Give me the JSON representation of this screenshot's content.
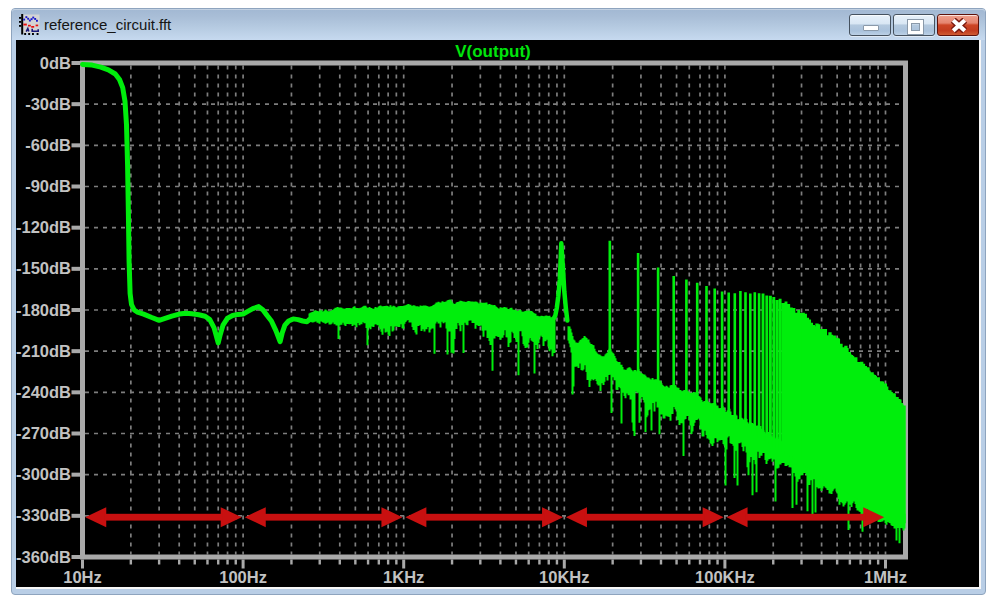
{
  "window": {
    "title": "reference_circuit.fft",
    "icon": "waveform-plot-icon",
    "buttons": {
      "minimize": "Minimize",
      "maximize": "Maximize",
      "close": "Close"
    }
  },
  "colors": {
    "frame": "#B9CEE6",
    "client_bg": "#000000",
    "plot_border": "#A9A9A9",
    "grid": "#7E7E7E",
    "axis_label": "#C2C2C2",
    "trace": "#00EE0C",
    "plot_title": "#00E40C",
    "arrow": "#C81010"
  },
  "chart_data": {
    "type": "line",
    "title": "V(output)",
    "xlabel": "",
    "ylabel": "",
    "x_axis": {
      "scale": "log",
      "unit": "Hz",
      "range_hz": [
        10,
        1330000
      ],
      "tick_labels": [
        "10Hz",
        "100Hz",
        "1KHz",
        "10KHz",
        "100KHz",
        "1MHz"
      ],
      "tick_values_hz": [
        10,
        100,
        1000,
        10000,
        100000,
        1000000
      ],
      "minor_multiples": [
        2,
        3,
        4,
        5,
        6,
        7,
        8,
        9,
        10
      ]
    },
    "y_axis": {
      "unit": "dB",
      "range_db": [
        -360,
        0
      ],
      "grid_step_db": 30,
      "tick_labels": [
        "0dB",
        "-30dB",
        "-60dB",
        "-90dB",
        "-120dB",
        "-150dB",
        "-180dB",
        "-210dB",
        "-240dB",
        "-270dB",
        "-300dB",
        "-330dB",
        "-360dB"
      ],
      "tick_values_db": [
        0,
        -30,
        -60,
        -90,
        -120,
        -150,
        -180,
        -210,
        -240,
        -270,
        -300,
        -330,
        -360
      ]
    },
    "grid": {
      "style": "dashed",
      "horizontal_at_db": [
        -30,
        -60,
        -90,
        -120,
        -150,
        -180,
        -210,
        -240,
        -270,
        -300,
        -330
      ]
    },
    "legend": {
      "position": "top-center",
      "entries": [
        "V(output)"
      ]
    },
    "series": [
      {
        "name": "V(output)",
        "color": "#00EE0C",
        "description": "FFT magnitude of V(output): 0dB fundamental plateau 10-19Hz, cliff to -180dB noise floor, resonance spike to -127dB near 9.6KHz, harmonic comb at multiples of 9.6KHz decaying into a dense wedge that rolls off to about -330dB at 1MHz",
        "clean_line_db": [
          [
            10,
            -1
          ],
          [
            11.5,
            -1.5
          ],
          [
            13,
            -3
          ],
          [
            14.5,
            -5
          ],
          [
            16,
            -8
          ],
          [
            17,
            -12
          ],
          [
            17.8,
            -18
          ],
          [
            18.4,
            -28
          ],
          [
            18.8,
            -45
          ],
          [
            19.1,
            -75
          ],
          [
            19.3,
            -110
          ],
          [
            19.5,
            -145
          ],
          [
            19.8,
            -168
          ],
          [
            20.2,
            -176
          ],
          [
            21,
            -180
          ],
          [
            22,
            -181.5
          ],
          [
            24,
            -183
          ],
          [
            27,
            -185.5
          ],
          [
            30,
            -187.5
          ],
          [
            33,
            -186
          ],
          [
            36,
            -184.5
          ],
          [
            40,
            -183
          ],
          [
            44,
            -182.3
          ],
          [
            48,
            -182.8
          ],
          [
            53,
            -183.5
          ],
          [
            58,
            -184.5
          ],
          [
            62,
            -187
          ],
          [
            66,
            -193
          ],
          [
            70,
            -204
          ],
          [
            72,
            -198
          ],
          [
            75,
            -191
          ],
          [
            80,
            -186
          ],
          [
            86,
            -184
          ],
          [
            93,
            -183.2
          ],
          [
            100,
            -183
          ],
          [
            107,
            -181
          ],
          [
            115,
            -179
          ],
          [
            125,
            -177.5
          ],
          [
            133,
            -180
          ],
          [
            141,
            -184
          ],
          [
            150,
            -188
          ],
          [
            160,
            -195
          ],
          [
            170,
            -203
          ],
          [
            175,
            -197
          ],
          [
            182,
            -191
          ],
          [
            192,
            -188
          ],
          [
            205,
            -186.5
          ],
          [
            220,
            -187
          ],
          [
            235,
            -188
          ],
          [
            250,
            -188.5
          ],
          [
            258,
            -187
          ]
        ],
        "noise_band_db": [
          [
            258,
            -182,
            -193
          ],
          [
            300,
            -180,
            -194
          ],
          [
            400,
            -179,
            -198
          ],
          [
            550,
            -178,
            -201
          ],
          [
            800,
            -177.5,
            -203
          ],
          [
            1200,
            -176.5,
            -205
          ],
          [
            1800,
            -174.5,
            -208
          ],
          [
            2600,
            -175,
            -212
          ],
          [
            3800,
            -177,
            -217
          ],
          [
            5200,
            -180,
            -221
          ],
          [
            6800,
            -184,
            -225
          ],
          [
            8600,
            -187,
            -228
          ]
        ],
        "resonance_line_db": [
          [
            8600,
            -187
          ],
          [
            8900,
            -181
          ],
          [
            9150,
            -172
          ],
          [
            9350,
            -160
          ],
          [
            9480,
            -146
          ],
          [
            9560,
            -134
          ],
          [
            9620,
            -127
          ],
          [
            9700,
            -136
          ],
          [
            9800,
            -150
          ],
          [
            9950,
            -163
          ],
          [
            10150,
            -175
          ],
          [
            10400,
            -186
          ],
          [
            10600,
            -192
          ]
        ],
        "floor_band_db": [
          [
            10600,
            -192,
            -214
          ],
          [
            11300,
            -200,
            -232
          ],
          [
            12000,
            -204,
            -240
          ],
          [
            13300,
            -197,
            -238
          ],
          [
            14500,
            -202,
            -242
          ],
          [
            16000,
            -210,
            -246
          ],
          [
            17500,
            -214,
            -248
          ],
          [
            19200,
            -210,
            -246
          ],
          [
            21000,
            -216,
            -250
          ],
          [
            24000,
            -222,
            -256
          ],
          [
            28800,
            -224,
            -258
          ],
          [
            34000,
            -228,
            -262
          ],
          [
            40000,
            -232,
            -266
          ],
          [
            48000,
            -235,
            -270
          ],
          [
            57600,
            -238,
            -274
          ],
          [
            70000,
            -243,
            -280
          ],
          [
            86000,
            -248,
            -288
          ],
          [
            100000,
            -252,
            -295
          ],
          [
            120000,
            -257,
            -300
          ],
          [
            150000,
            -263,
            -306
          ],
          [
            200000,
            -271,
            -305
          ],
          [
            260000,
            -279,
            -311
          ],
          [
            340000,
            -288,
            -317
          ],
          [
            450000,
            -297,
            -323
          ],
          [
            600000,
            -306,
            -328
          ],
          [
            800000,
            -315,
            -334
          ],
          [
            1050000,
            -322,
            -340
          ],
          [
            1340000,
            -328,
            -344
          ]
        ],
        "comb": {
          "fundamental_hz": 9600,
          "tooth_top_db": [
            [
              19200,
              -131
            ],
            [
              28800,
              -139
            ],
            [
              38400,
              -148
            ],
            [
              48000,
              -154
            ],
            [
              57600,
              -158.5
            ],
            [
              67200,
              -161
            ],
            [
              76800,
              -162.5
            ],
            [
              86400,
              -164
            ],
            [
              96000,
              -165.5
            ],
            [
              115000,
              -166.5
            ],
            [
              140000,
              -166.5
            ],
            [
              170000,
              -167.5
            ],
            [
              210000,
              -171
            ],
            [
              260000,
              -178
            ],
            [
              330000,
              -186
            ],
            [
              400000,
              -193
            ],
            [
              500000,
              -202
            ],
            [
              630000,
              -214
            ],
            [
              800000,
              -225
            ],
            [
              1000000,
              -236
            ],
            [
              1180000,
              -245
            ],
            [
              1340000,
              -253
            ]
          ]
        },
        "noise_seed": 1337
      }
    ],
    "annotations": {
      "decade_arrows": {
        "color": "#C81010",
        "y_db": -331,
        "style": "double-headed",
        "segments_hz": [
          [
            10.4,
            98.0
          ],
          [
            102.4,
            982.0
          ],
          [
            1024.0,
            9820.0
          ],
          [
            10240.0,
            98200.0
          ],
          [
            102400.0,
            982000.0
          ]
        ]
      }
    }
  }
}
